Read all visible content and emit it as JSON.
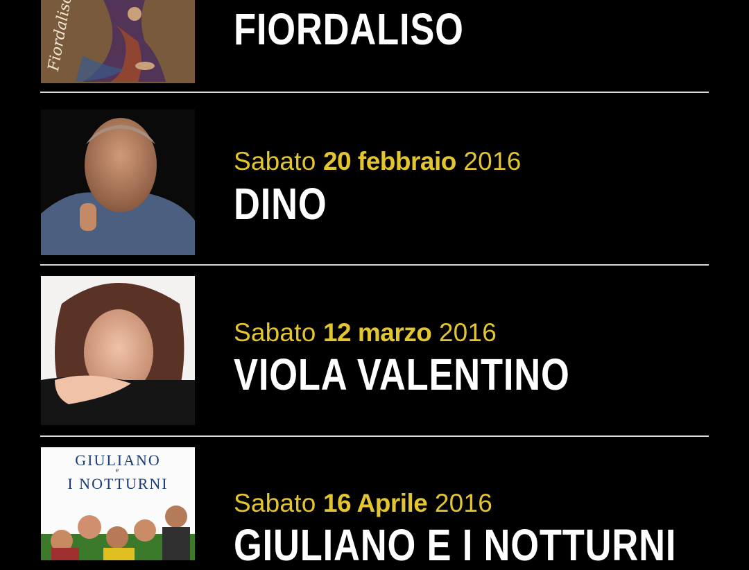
{
  "events": [
    {
      "weekday": "",
      "day_month": "",
      "year": "",
      "artist": "FIORDALISO",
      "photo_caption": "Fiordaliso"
    },
    {
      "weekday": "Sabato",
      "day_month": "20 febbraio",
      "year": "2016",
      "artist": "DINO"
    },
    {
      "weekday": "Sabato",
      "day_month": "12 marzo",
      "year": "2016",
      "artist": "VIOLA VALENTINO"
    },
    {
      "weekday": "Sabato",
      "day_month": "16 Aprile",
      "year": "2016",
      "artist": "GIULIANO E I NOTTURNI",
      "cover_line1": "GIULIANO",
      "cover_and": "e",
      "cover_line2": "I NOTTURNI"
    }
  ],
  "colors": {
    "background": "#000000",
    "date_accent": "#e3c62f",
    "artist_text": "#ffffff",
    "divider": "#d9d9d9"
  }
}
